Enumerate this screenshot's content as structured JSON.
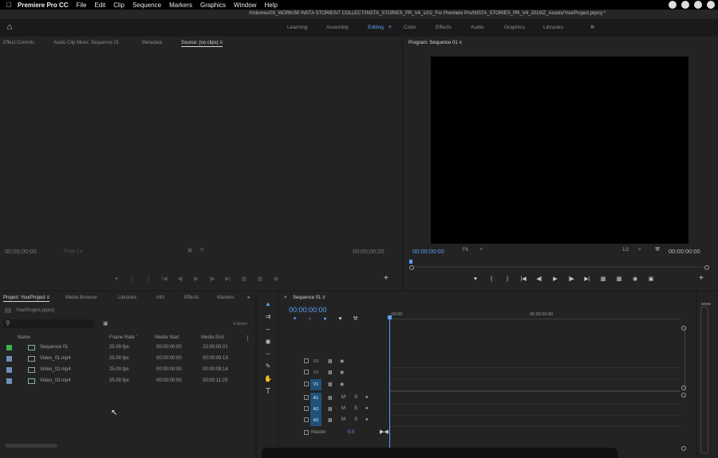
{
  "menubar": {
    "app_name": "Premiere Pro CC",
    "items": [
      "File",
      "Edit",
      "Clip",
      "Sequence",
      "Markers",
      "Graphics",
      "Window",
      "Help"
    ]
  },
  "titlebar": {
    "path": "/Volumes/03_WORK/50 INSTA STORIES/7 COLLECT/INSTA_STORIES_PR_V4_1/02_For Premiere Pro/INSTA_STORIES_PR_V4_2019/Z_Assets/YourProject.prproj *"
  },
  "workspaces": {
    "items": [
      "Learning",
      "Assembly",
      "Editing",
      "Color",
      "Effects",
      "Audio",
      "Graphics",
      "Libraries"
    ],
    "active": "Editing"
  },
  "source_panel": {
    "tabs": [
      "Effect Controls",
      "Audio Clip Mixer: Sequence 01",
      "Metadata",
      "Source: (no clips)"
    ],
    "timecode_left": "00;00;00;00",
    "timecode_right": "00;00;00;00",
    "page_label": "Page 1"
  },
  "program_panel": {
    "title": "Program: Sequence 01",
    "timecode_left": "00:00:00:00",
    "fit_label": "Fit",
    "resolution": "1/2",
    "timecode_right": "00:00:00:00"
  },
  "project_panel": {
    "tabs": [
      "Project: YourProject",
      "Media Browser",
      "Libraries",
      "Info",
      "Effects",
      "Markers"
    ],
    "project_file": "YourProject.prproj",
    "items_count": "4 Items",
    "columns": [
      "Name",
      "Frame Rate",
      "Media Start",
      "Media End"
    ],
    "rows": [
      {
        "name": "Sequence 01",
        "frame_rate": "25.00 fps",
        "media_start": "00:00:00:00",
        "media_end": "23:00:00:01",
        "color": "#3fb34f"
      },
      {
        "name": "Video_01.mp4",
        "frame_rate": "25.00 fps",
        "media_start": "00:00:00:00",
        "media_end": "00:00:09:13",
        "color": "#6f8fb8"
      },
      {
        "name": "Video_02.mp4",
        "frame_rate": "25.00 fps",
        "media_start": "00:00:00:00",
        "media_end": "00:00:09:14",
        "color": "#6f8fb8"
      },
      {
        "name": "Video_03.mp4",
        "frame_rate": "25.00 fps",
        "media_start": "00:00:00:00",
        "media_end": "00:00:11:23",
        "color": "#6f8fb8"
      }
    ]
  },
  "timeline": {
    "tab": "Sequence 01",
    "timecode": "00:00:00:00",
    "ruler_start": ":00:00",
    "ruler_mark": "00:05:00:00",
    "video_tracks": [
      "V3",
      "V2",
      "V1"
    ],
    "audio_tracks": [
      "A1",
      "A2",
      "A3"
    ],
    "master_label": "Master",
    "master_value": "0.0",
    "mute_label": "M",
    "solo_label": "S"
  }
}
